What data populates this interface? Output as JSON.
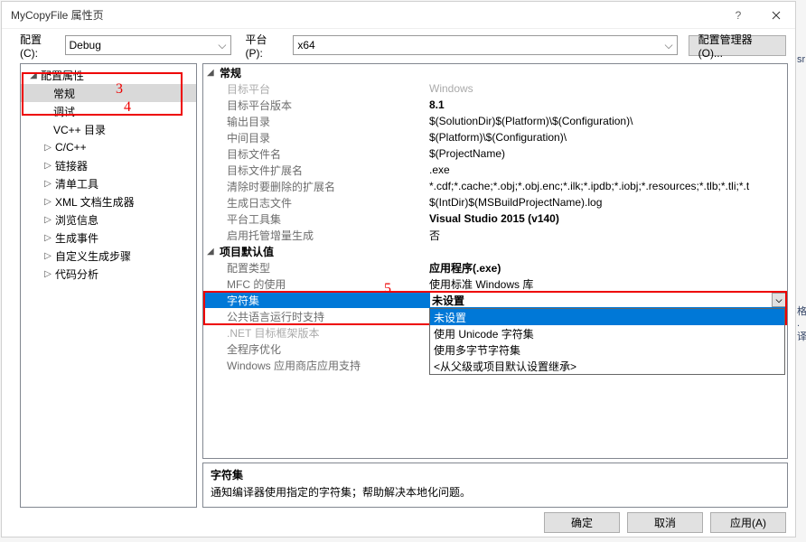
{
  "title": "MyCopyFile 属性页",
  "toolbar": {
    "config_label": "配置(C):",
    "config_value": "Debug",
    "platform_label": "平台(P):",
    "platform_value": "x64",
    "manager_btn": "配置管理器(O)..."
  },
  "annotations": {
    "n3": "3",
    "n4": "4",
    "n5": "5"
  },
  "tree": {
    "root": "配置属性",
    "items": [
      {
        "label": "常规",
        "selected": true
      },
      {
        "label": "调试"
      },
      {
        "label": "VC++ 目录"
      },
      {
        "label": "C/C++",
        "exp": true
      },
      {
        "label": "链接器",
        "exp": true
      },
      {
        "label": "清单工具",
        "exp": true
      },
      {
        "label": "XML 文档生成器",
        "exp": true
      },
      {
        "label": "浏览信息",
        "exp": true
      },
      {
        "label": "生成事件",
        "exp": true
      },
      {
        "label": "自定义生成步骤",
        "exp": true
      },
      {
        "label": "代码分析",
        "exp": true
      }
    ]
  },
  "groups": [
    {
      "label": "常规",
      "rows": [
        {
          "k": "目标平台",
          "v": "Windows",
          "dim": true
        },
        {
          "k": "目标平台版本",
          "v": "8.1",
          "bold": true
        },
        {
          "k": "输出目录",
          "v": "$(SolutionDir)$(Platform)\\$(Configuration)\\"
        },
        {
          "k": "中间目录",
          "v": "$(Platform)\\$(Configuration)\\"
        },
        {
          "k": "目标文件名",
          "v": "$(ProjectName)"
        },
        {
          "k": "目标文件扩展名",
          "v": ".exe"
        },
        {
          "k": "清除时要删除的扩展名",
          "v": "*.cdf;*.cache;*.obj;*.obj.enc;*.ilk;*.ipdb;*.iobj;*.resources;*.tlb;*.tli;*.t"
        },
        {
          "k": "生成日志文件",
          "v": "$(IntDir)$(MSBuildProjectName).log"
        },
        {
          "k": "平台工具集",
          "v": "Visual Studio 2015 (v140)",
          "bold": true
        },
        {
          "k": "启用托管增量生成",
          "v": "否"
        }
      ]
    },
    {
      "label": "项目默认值",
      "rows": [
        {
          "k": "配置类型",
          "v": "应用程序(.exe)",
          "bold": true
        },
        {
          "k": "MFC 的使用",
          "v": "使用标准 Windows 库"
        },
        {
          "k": "字符集",
          "v": "未设置",
          "selected": true,
          "bold": true
        },
        {
          "k": "公共语言运行时支持",
          "v": ""
        },
        {
          "k": ".NET 目标框架版本",
          "v": "",
          "dim": true
        },
        {
          "k": "全程序优化",
          "v": ""
        },
        {
          "k": "Windows 应用商店应用支持",
          "v": ""
        }
      ]
    }
  ],
  "dropdown": {
    "items": [
      {
        "label": "未设置",
        "sel": true
      },
      {
        "label": "使用 Unicode 字符集"
      },
      {
        "label": "使用多字节字符集"
      },
      {
        "label": "<从父级或项目默认设置继承>"
      }
    ]
  },
  "desc": {
    "title": "字符集",
    "text": "通知编译器使用指定的字符集；帮助解决本地化问题。"
  },
  "footer": {
    "ok": "确定",
    "cancel": "取消",
    "apply": "应用(A)"
  }
}
